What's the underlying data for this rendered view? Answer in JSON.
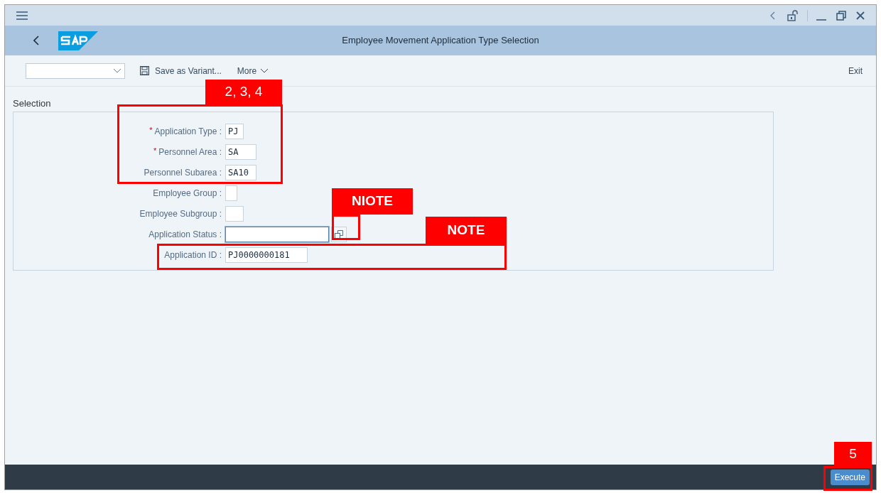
{
  "window": {
    "title": "Employee Movement Application Type Selection"
  },
  "toolbar": {
    "save_variant": "Save as Variant...",
    "more": "More",
    "exit": "Exit"
  },
  "section": {
    "title": "Selection"
  },
  "fields": [
    {
      "label": "Application Type :",
      "value": "PJ",
      "required_mark": "*",
      "focused": false,
      "value_help": false
    },
    {
      "label": "Personnel Area :",
      "value": "SA",
      "required_mark": "*",
      "focused": false,
      "value_help": false
    },
    {
      "label": "Personnel Subarea :",
      "value": "SA10",
      "focused": false,
      "value_help": false
    },
    {
      "label": "Employee Group :",
      "focused": false,
      "value_help": false
    },
    {
      "label": "Employee Subgroup :",
      "focused": false,
      "value_help": false
    },
    {
      "label": "Application Status :",
      "focused": true,
      "value_help": true
    },
    {
      "label": "Application ID :",
      "value": "PJ0000000181",
      "focused": false,
      "value_help": false
    }
  ],
  "footer": {
    "execute": "Execute"
  },
  "annotations": [
    {
      "label": "2, 3, 4",
      "bold": false
    },
    {
      "label": "NIOTE",
      "bold": true
    },
    {
      "label": "NOTE",
      "bold": true
    },
    {
      "label": "5",
      "bold": false
    }
  ]
}
